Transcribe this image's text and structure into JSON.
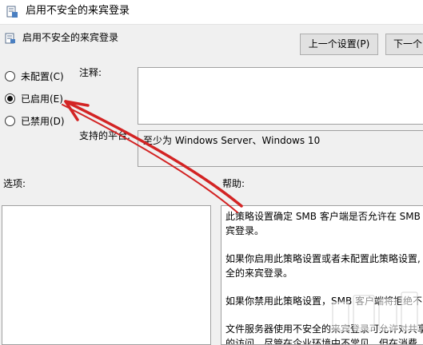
{
  "window": {
    "title": "启用不安全的来宾登录",
    "icon": "policy-setting-icon"
  },
  "header": {
    "title": "启用不安全的来宾登录",
    "icon": "policy-setting-icon"
  },
  "buttons": {
    "prev": "上一个设置(P)",
    "next": "下一个"
  },
  "radio_options": [
    {
      "label": "未配置(C)",
      "checked": false
    },
    {
      "label": "已启用(E)",
      "checked": true
    },
    {
      "label": "已禁用(D)",
      "checked": false
    }
  ],
  "labels": {
    "comment": "注释:",
    "supported_on": "支持的平台:",
    "options": "选项:",
    "help": "帮助:"
  },
  "supported_value": "至少为 Windows Server、Windows 10",
  "help_paragraphs": [
    [
      "此策略设置确定 SMB 客户端是否允许在 SMB",
      "宾登录。"
    ],
    [
      "如果你启用此策略设置或者未配置此策略设置,",
      "全的来宾登录。"
    ],
    [
      "如果你禁用此策略设置，SMB 客户端将拒绝不"
    ],
    [
      "文件服务器使用不安全的来宾登录可允许对共享",
      "的访问。尽管在企业环境中不常见，但在消费"
    ]
  ],
  "annotation": {
    "arrow_color": "#d32424"
  }
}
